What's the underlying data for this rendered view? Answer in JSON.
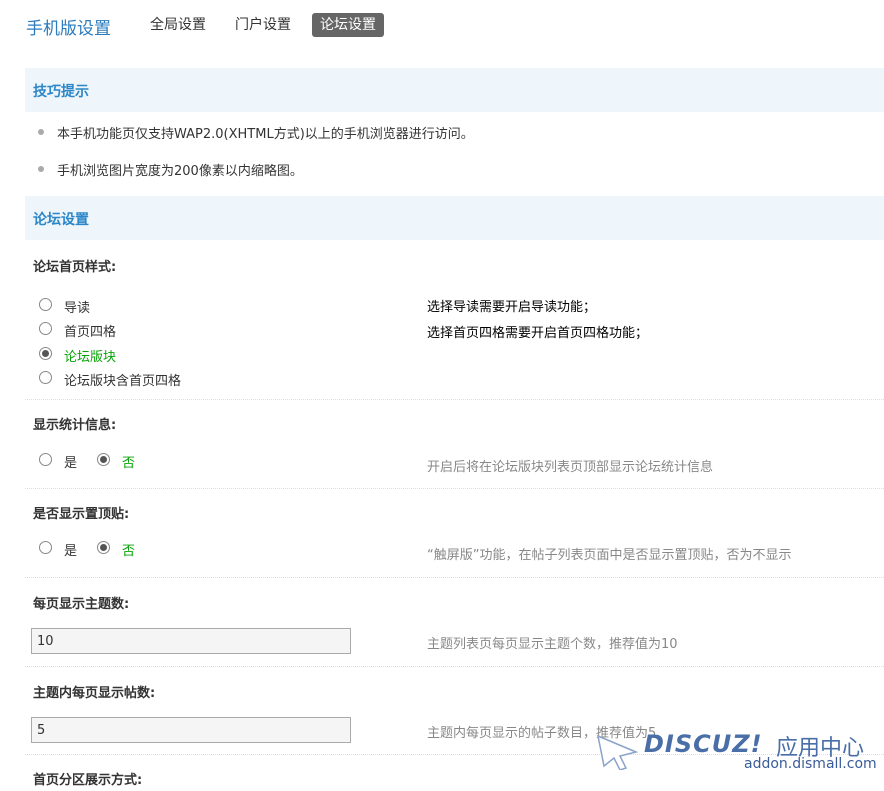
{
  "header": {
    "title": "手机版设置",
    "tabs": [
      "全局设置",
      "门户设置",
      "论坛设置"
    ],
    "active_tab": "论坛设置"
  },
  "tips": {
    "title": "技巧提示",
    "items": [
      "本手机功能页仅支持WAP2.0(XHTML方式)以上的手机浏览器进行访问。",
      "手机浏览图片宽度为200像素以内缩略图。"
    ]
  },
  "forum": {
    "section_title": "论坛设置",
    "homepage_style": {
      "label": "论坛首页样式:",
      "options": [
        "导读",
        "首页四格",
        "论坛版块",
        "论坛版块含首页四格"
      ],
      "selected": "论坛版块",
      "hint1": "选择导读需要开启导读功能；",
      "hint2": "选择首页四格需要开启首页四格功能；"
    },
    "show_stats": {
      "label": "显示统计信息:",
      "yes": "是",
      "no": "否",
      "selected": "否",
      "hint": "开启后将在论坛版块列表页顶部显示论坛统计信息"
    },
    "show_sticky": {
      "label": "是否显示置顶贴:",
      "yes": "是",
      "no": "否",
      "selected": "否",
      "hint": "“触屏版”功能，在帖子列表页面中是否显示置顶贴，否为不显示"
    },
    "topics_per_page": {
      "label": "每页显示主题数:",
      "value": "10",
      "hint": "主题列表页每页显示主题个数，推荐值为10"
    },
    "posts_per_page": {
      "label": "主题内每页显示帖数:",
      "value": "5",
      "hint": "主题内每页显示的帖子数目，推荐值为5"
    },
    "section_display": {
      "label": "首页分区展示方式:"
    }
  },
  "watermark": {
    "logo": "DISCUZ!",
    "cn": "应用中心",
    "url": "addon.dismall.com"
  }
}
